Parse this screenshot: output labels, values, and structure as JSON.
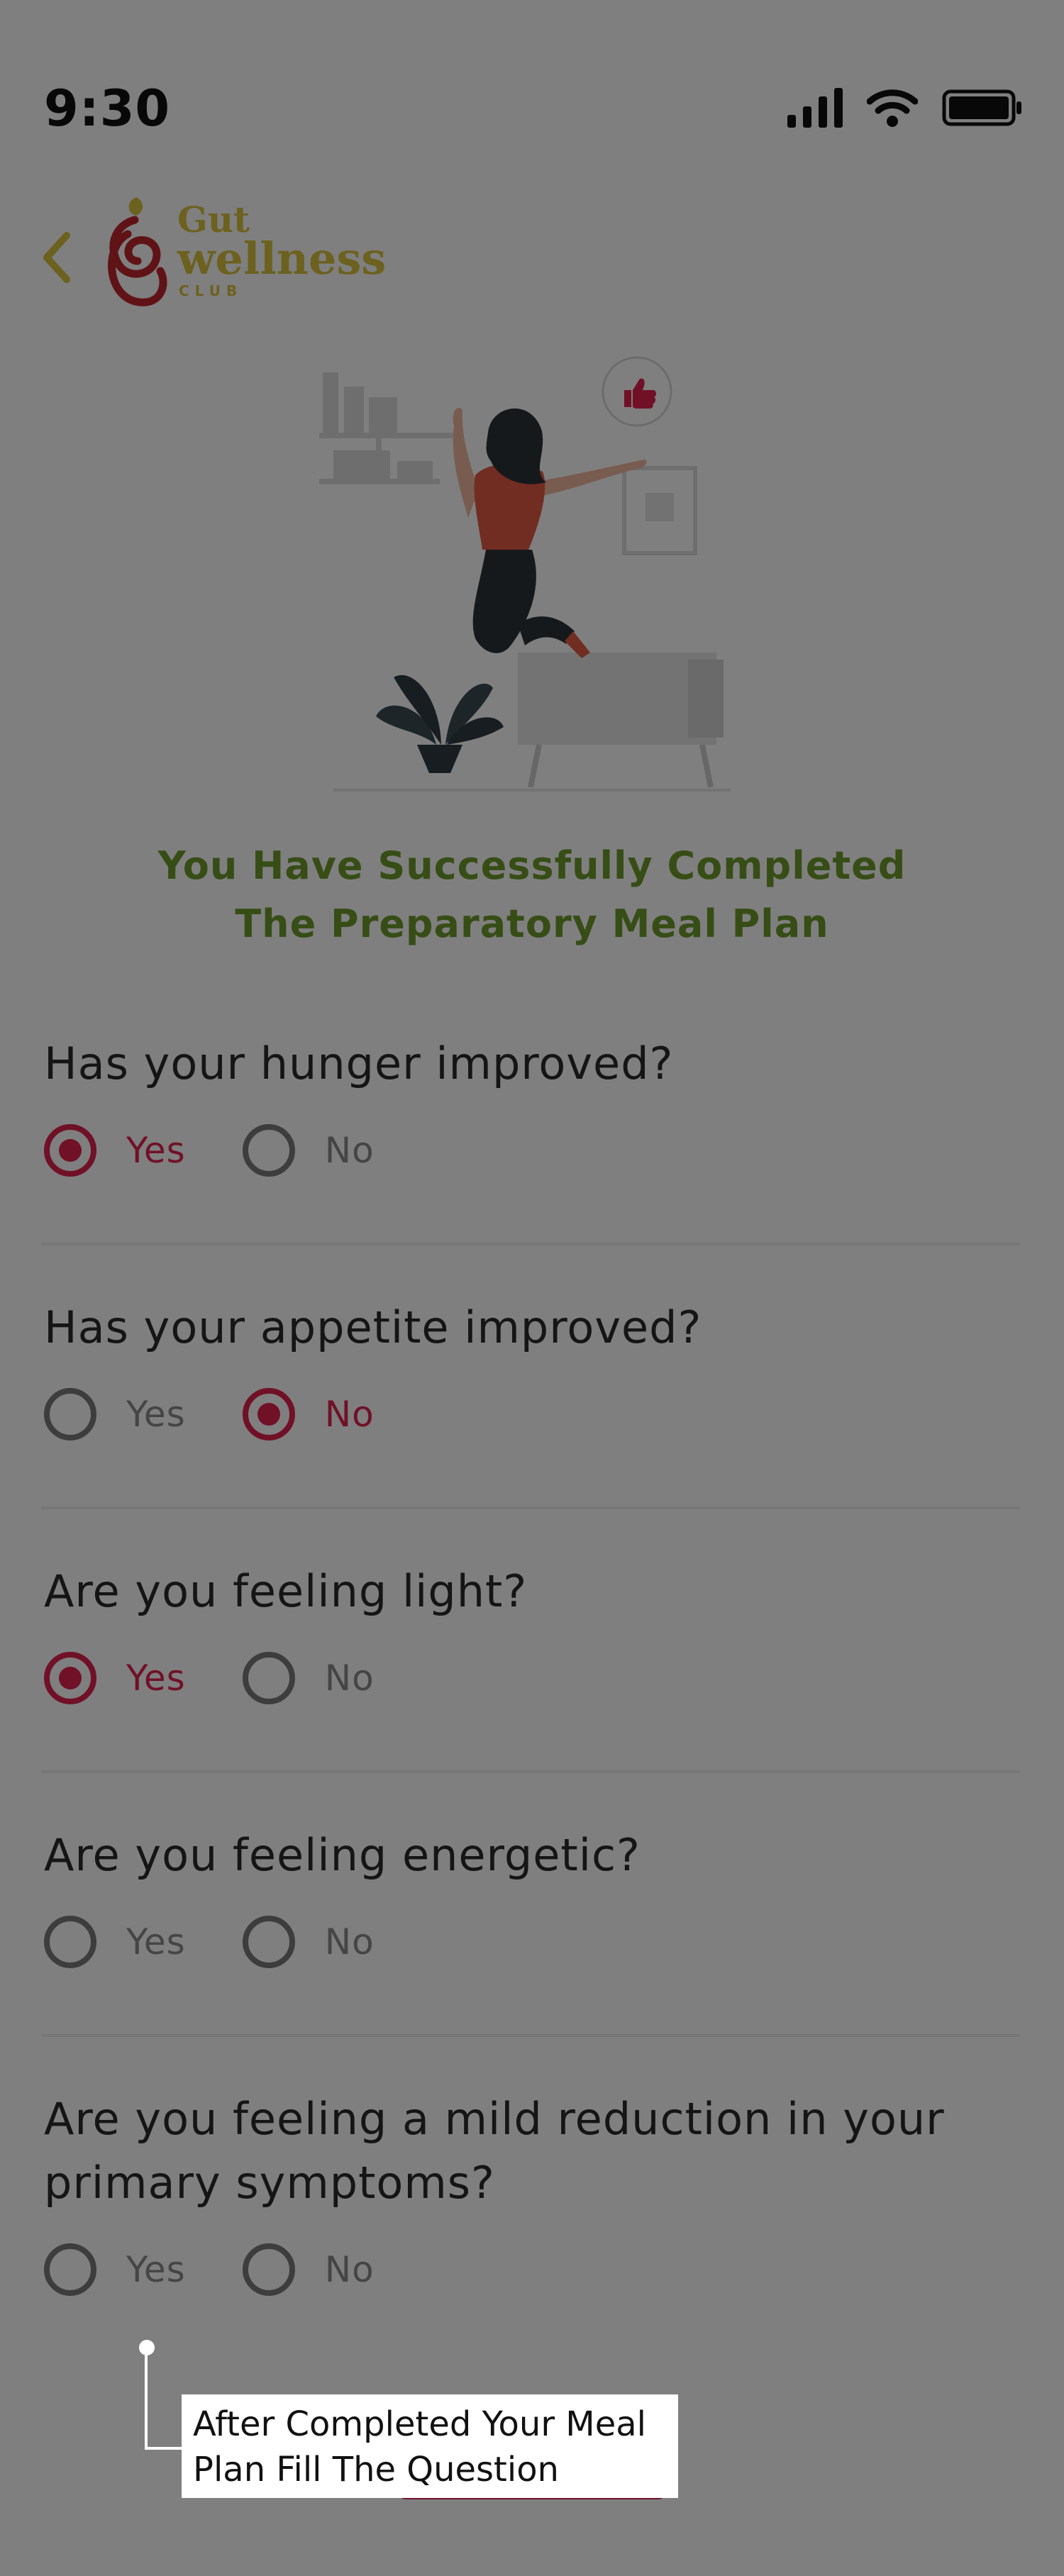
{
  "status_bar": {
    "time": "9:30",
    "icons": [
      "cellular-signal-icon",
      "wifi-icon",
      "battery-icon"
    ]
  },
  "header": {
    "back_icon": "chevron-left-icon",
    "logo": {
      "line1": "Gut",
      "line2": "wellness",
      "line3": "CLUB"
    }
  },
  "illustration": {
    "icon": "thumbs-up-icon"
  },
  "success_message": {
    "line1": "You Have Successfully Completed",
    "line2": "The Preparatory Meal Plan"
  },
  "questions": [
    {
      "label": "Has your hunger improved?",
      "options": [
        "Yes",
        "No"
      ],
      "selected": "Yes"
    },
    {
      "label": "Has your appetite improved?",
      "options": [
        "Yes",
        "No"
      ],
      "selected": "No"
    },
    {
      "label": "Are you feeling light?",
      "options": [
        "Yes",
        "No"
      ],
      "selected": "Yes"
    },
    {
      "label": "Are you feeling energetic?",
      "options": [
        "Yes",
        "No"
      ],
      "selected": null
    },
    {
      "label": "Are you feeling a mild reduction in your primary symptoms?",
      "options": [
        "Yes",
        "No"
      ],
      "selected": null
    }
  ],
  "tooltip": {
    "line1": "After Completed Your Meal",
    "line2": "Plan Fill The Question"
  },
  "colors": {
    "accent": "#e0234e",
    "success_text": "#6f9a2c",
    "logo_gold": "#d8c33e",
    "logo_red": "#c0272d",
    "overlay": "rgba(0,0,0,0.5)"
  }
}
